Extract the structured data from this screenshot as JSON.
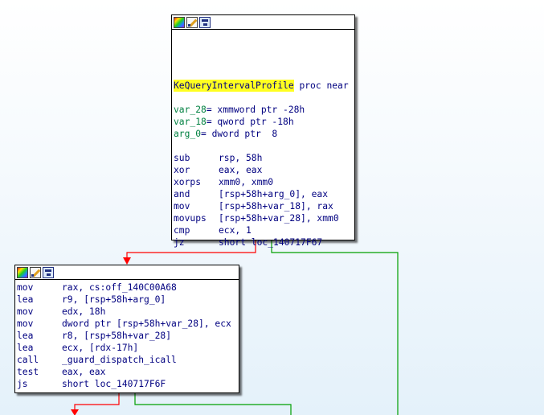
{
  "colors": {
    "true_edge": "#ff0000",
    "false_edge": "#00a000",
    "label_highlight": "#ffff20",
    "code_text": "#000080",
    "operand_var": "#008040"
  },
  "header_icons": [
    "color-palette-icon",
    "edit-pen-icon",
    "graph-overview-icon"
  ],
  "block1": {
    "proc_name": "KeQueryIntervalProfile",
    "proc_kw": " proc near",
    "vars": [
      {
        "name": "var_28",
        "def": "= xmmword ptr -28h"
      },
      {
        "name": "var_18",
        "def": "= qword ptr -18h"
      },
      {
        "name": "arg_0",
        "def": "= dword ptr  8"
      }
    ],
    "instructions": [
      {
        "mnem": "sub",
        "ops": "rsp, 58h"
      },
      {
        "mnem": "xor",
        "ops": "eax, eax"
      },
      {
        "mnem": "xorps",
        "ops": "xmm0, xmm0"
      },
      {
        "mnem": "and",
        "ops": "[rsp+58h+arg_0], eax"
      },
      {
        "mnem": "mov",
        "ops": "[rsp+58h+var_18], rax"
      },
      {
        "mnem": "movups",
        "ops": "[rsp+58h+var_28], xmm0"
      },
      {
        "mnem": "cmp",
        "ops": "ecx, 1"
      },
      {
        "mnem": "jz",
        "ops": "short loc_140717F67"
      }
    ]
  },
  "block2": {
    "instructions": [
      {
        "mnem": "mov",
        "ops": "rax, cs:off_140C00A68"
      },
      {
        "mnem": "lea",
        "ops": "r9, [rsp+58h+arg_0]"
      },
      {
        "mnem": "mov",
        "ops": "edx, 18h"
      },
      {
        "mnem": "mov",
        "ops": "dword ptr [rsp+58h+var_28], ecx"
      },
      {
        "mnem": "lea",
        "ops": "r8, [rsp+58h+var_28]"
      },
      {
        "mnem": "lea",
        "ops": "ecx, [rdx-17h]"
      },
      {
        "mnem": "call",
        "ops": "_guard_dispatch_icall"
      },
      {
        "mnem": "test",
        "ops": "eax, eax"
      },
      {
        "mnem": "js",
        "ops": "short loc_140717F6F"
      }
    ]
  }
}
